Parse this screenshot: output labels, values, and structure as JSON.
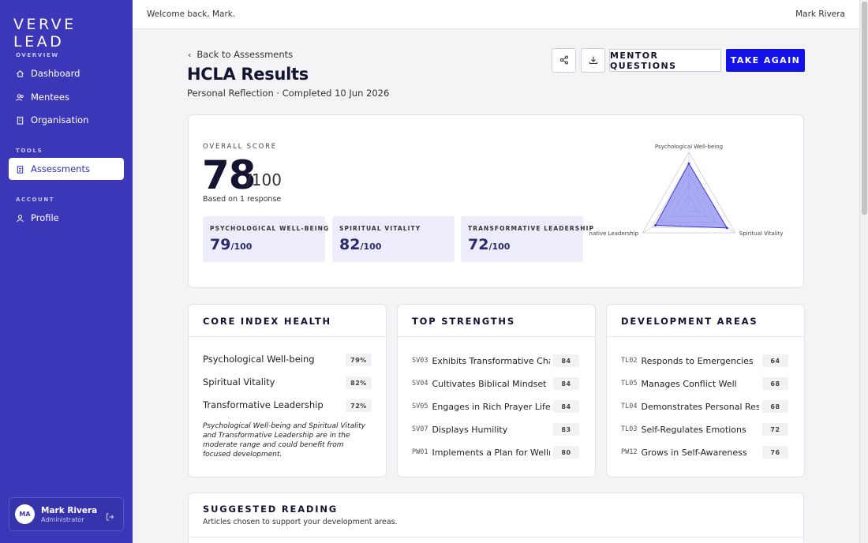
{
  "brand": {
    "logo": "VERVE LEAD",
    "accent": "#3b37b8",
    "primary_button": "#1212e8"
  },
  "sidebar": {
    "sections": [
      {
        "label": "OVERVIEW"
      },
      {
        "label": "TOOLS"
      },
      {
        "label": "ACCOUNT"
      }
    ],
    "items": [
      {
        "label": "Dashboard",
        "icon": "home-icon"
      },
      {
        "label": "Mentees",
        "icon": "users-icon"
      },
      {
        "label": "Organisation",
        "icon": "building-icon"
      },
      {
        "label": "Assessments",
        "icon": "clipboard-icon",
        "active": true
      },
      {
        "label": "Profile",
        "icon": "user-icon"
      }
    ],
    "user": {
      "initials": "MA",
      "name": "Mark Rivera",
      "role": "Administrator"
    }
  },
  "topbar": {
    "welcome": "Welcome back, Mark.",
    "user": "Mark Rivera"
  },
  "header": {
    "back": "Back to Assessments",
    "title": "HCLA Results",
    "subtitle": "Personal Reflection · Completed 10 Jun 2026",
    "mentor_button": "MENTOR QUESTIONS",
    "take_again_button": "TAKE AGAIN"
  },
  "overall": {
    "label": "OVERALL SCORE",
    "score": "78",
    "denominator": "/100",
    "based_on": "Based on 1 response",
    "subscores": [
      {
        "label": "PSYCHOLOGICAL WELL-BEING",
        "value": "79",
        "den": "/100"
      },
      {
        "label": "SPIRITUAL VITALITY",
        "value": "82",
        "den": "/100"
      },
      {
        "label": "TRANSFORMATIVE LEADERSHIP",
        "value": "72",
        "den": "/100"
      }
    ]
  },
  "chart_data": {
    "type": "radar",
    "axes": [
      "Psychological Well-being",
      "Spiritual Vitality",
      "Transformative Leadership"
    ],
    "values": [
      79,
      82,
      72
    ],
    "range": [
      0,
      100
    ],
    "gridlines": 5,
    "fill_color": "#8c8cf0",
    "stroke_color": "#3b37d8"
  },
  "core_index": {
    "title": "CORE INDEX HEALTH",
    "rows": [
      {
        "label": "Psychological Well-being",
        "value": "79%"
      },
      {
        "label": "Spiritual Vitality",
        "value": "82%"
      },
      {
        "label": "Transformative Leadership",
        "value": "72%"
      }
    ],
    "note": "Psychological Well-being and Spiritual Vitality and Transformative Leadership are in the moderate range and could benefit from focused development."
  },
  "strengths": {
    "title": "TOP STRENGTHS",
    "items": [
      {
        "code": "SV03",
        "name": "Exhibits Transformative Character",
        "score": "84"
      },
      {
        "code": "SV04",
        "name": "Cultivates Biblical Mindset",
        "score": "84"
      },
      {
        "code": "SV05",
        "name": "Engages in Rich Prayer Life",
        "score": "84"
      },
      {
        "code": "SV07",
        "name": "Displays Humility",
        "score": "83"
      },
      {
        "code": "PW01",
        "name": "Implements a Plan for Wellness",
        "score": "80"
      }
    ]
  },
  "development": {
    "title": "DEVELOPMENT AREAS",
    "items": [
      {
        "code": "TL02",
        "name": "Responds to Emergencies",
        "score": "64"
      },
      {
        "code": "TL05",
        "name": "Manages Conflict Well",
        "score": "68"
      },
      {
        "code": "TL04",
        "name": "Demonstrates Personal Responsibility",
        "score": "68"
      },
      {
        "code": "TL03",
        "name": "Self-Regulates Emotions",
        "score": "72"
      },
      {
        "code": "PW12",
        "name": "Grows in Self-Awareness",
        "score": "76"
      }
    ]
  },
  "reading": {
    "title": "SUGGESTED READING",
    "subtitle": "Articles chosen to support your development areas."
  }
}
